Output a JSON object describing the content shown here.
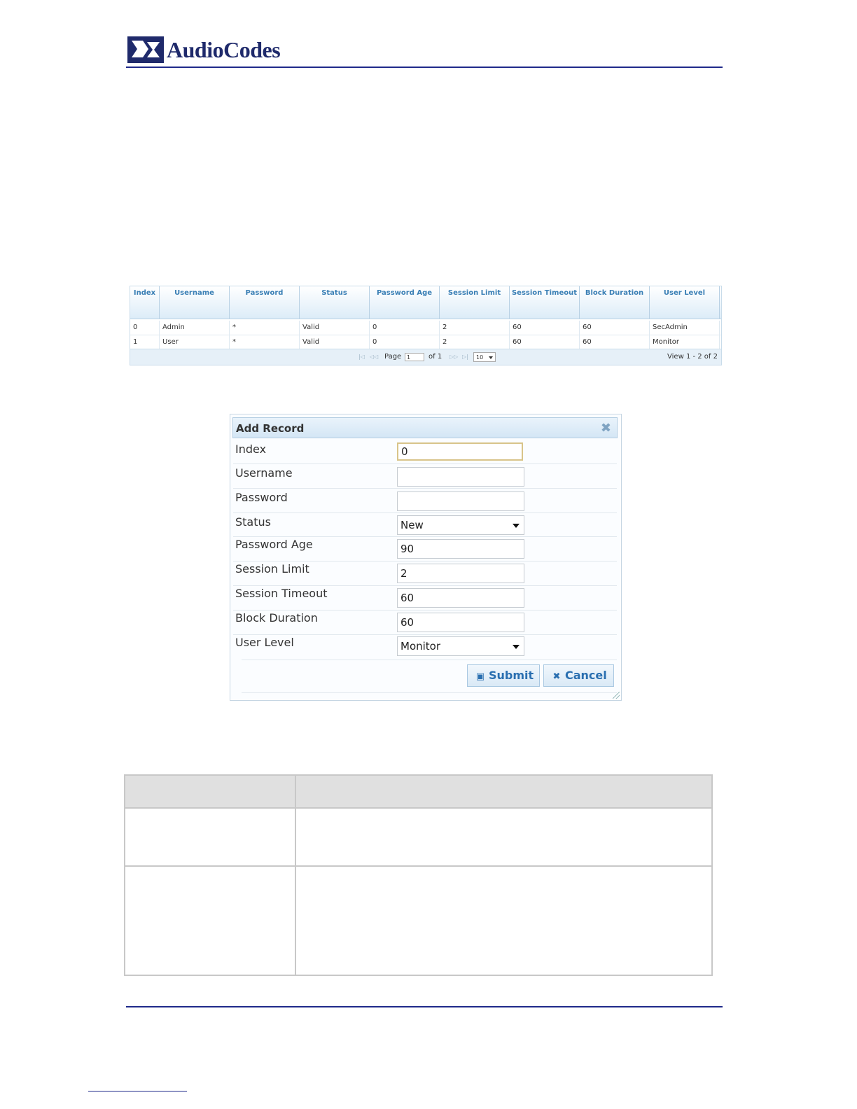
{
  "header": {
    "logo_text": "AudioCodes"
  },
  "users_table": {
    "columns": [
      "Index",
      "Username",
      "Password",
      "Status",
      "Password Age",
      "Session Limit",
      "Session Timeout",
      "Block Duration",
      "User Level"
    ],
    "rows": [
      [
        "0",
        "Admin",
        "*",
        "Valid",
        "0",
        "2",
        "60",
        "60",
        "SecAdmin"
      ],
      [
        "1",
        "User",
        "*",
        "Valid",
        "0",
        "2",
        "60",
        "60",
        "Monitor"
      ]
    ],
    "pager": {
      "first": "|◁",
      "prev": "◁◁",
      "page_label": "Page",
      "page_value": "1",
      "of_label": "of 1",
      "next": "▷▷",
      "last": "▷|",
      "rows_per_page": "10",
      "view_text": "View 1 - 2 of 2"
    }
  },
  "dialog": {
    "title": "Add Record",
    "fields": [
      {
        "label": "Index",
        "value": "0",
        "type": "text"
      },
      {
        "label": "Username",
        "value": "",
        "type": "text"
      },
      {
        "label": "Password",
        "value": "",
        "type": "text"
      },
      {
        "label": "Status",
        "value": "New",
        "type": "select"
      },
      {
        "label": "Password Age",
        "value": "90",
        "type": "text"
      },
      {
        "label": "Session Limit",
        "value": "2",
        "type": "text"
      },
      {
        "label": "Session Timeout",
        "value": "60",
        "type": "text"
      },
      {
        "label": "Block Duration",
        "value": "60",
        "type": "text"
      },
      {
        "label": "User Level",
        "value": "Monitor",
        "type": "select"
      }
    ],
    "submit_label": "Submit",
    "cancel_label": "Cancel"
  },
  "colors": {
    "brand": "#1f2a6b",
    "rule": "#1f2a8a",
    "grid_header_text": "#3a7fb5",
    "button_text": "#2a6fb0"
  },
  "icons": [
    "audiocodes-logo",
    "close-icon",
    "save-icon",
    "cancel-icon",
    "dropdown-arrow-icon",
    "resize-grip-icon"
  ]
}
